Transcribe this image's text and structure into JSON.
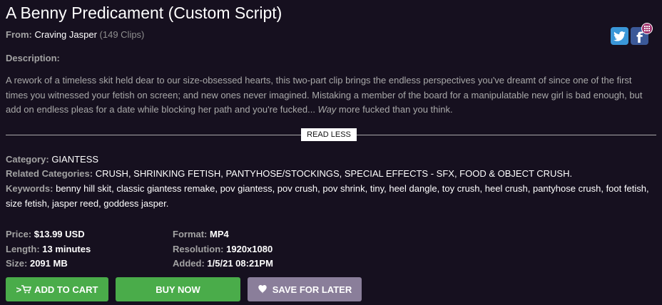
{
  "clip": {
    "title": "A Benny Predicament (Custom Script)",
    "from_label": "From:",
    "studio": "Craving Jasper",
    "clip_count": "(149 Clips)"
  },
  "social": {
    "twitter_icon": "twitter-icon",
    "facebook_icon": "facebook-icon",
    "share_badge_icon": "grid-icon",
    "twitter_color": "#3a97d8",
    "facebook_color": "#3b5998"
  },
  "description": {
    "label": "Description:",
    "text_main": "A rework of a timeless skit held dear to our size-obsessed hearts, this two-part clip brings the endless  perspectives you've dreamt of since one of the first times you witnessed your fetish on screen; and new ones never imagined. Mistaking a member of the board for a manipulatable new girl is bad enough, but add on endless pleas for a date while blocking her path and you're fucked... ",
    "text_emphasis": "Way",
    "text_end": " more fucked than you think.",
    "toggle_label": "READ LESS"
  },
  "meta": {
    "category_label": "Category:",
    "category": "GIANTESS",
    "related_label": "Related Categories:",
    "related": "CRUSH, SHRINKING FETISH, PANTYHOSE/STOCKINGS, SPECIAL EFFECTS - SFX, FOOD & OBJECT CRUSH.",
    "keywords_label": "Keywords:",
    "keywords": "benny hill skit, classic giantess remake, pov giantess, pov crush, pov shrink, tiny, heel dangle, toy crush, heel crush, pantyhose crush, foot fetish, size fetish, jasper reed, goddess jasper."
  },
  "specs": {
    "price_label": "Price:",
    "price": "$13.99 USD",
    "length_label": "Length:",
    "length": "13 minutes",
    "size_label": "Size:",
    "size": "2091 MB",
    "format_label": "Format:",
    "format": "MP4",
    "resolution_label": "Resolution:",
    "resolution": "1920x1080",
    "added_label": "Added:",
    "added": "1/5/21 08:21PM"
  },
  "actions": {
    "cart_prefix": ">",
    "cart_label": "ADD TO CART",
    "buy_label": "BUY NOW",
    "save_label": "SAVE FOR LATER",
    "cart_icon": "cart-icon",
    "save_icon": "heart-icon",
    "green": "#4aac4a",
    "purple": "#8a7e9a"
  }
}
